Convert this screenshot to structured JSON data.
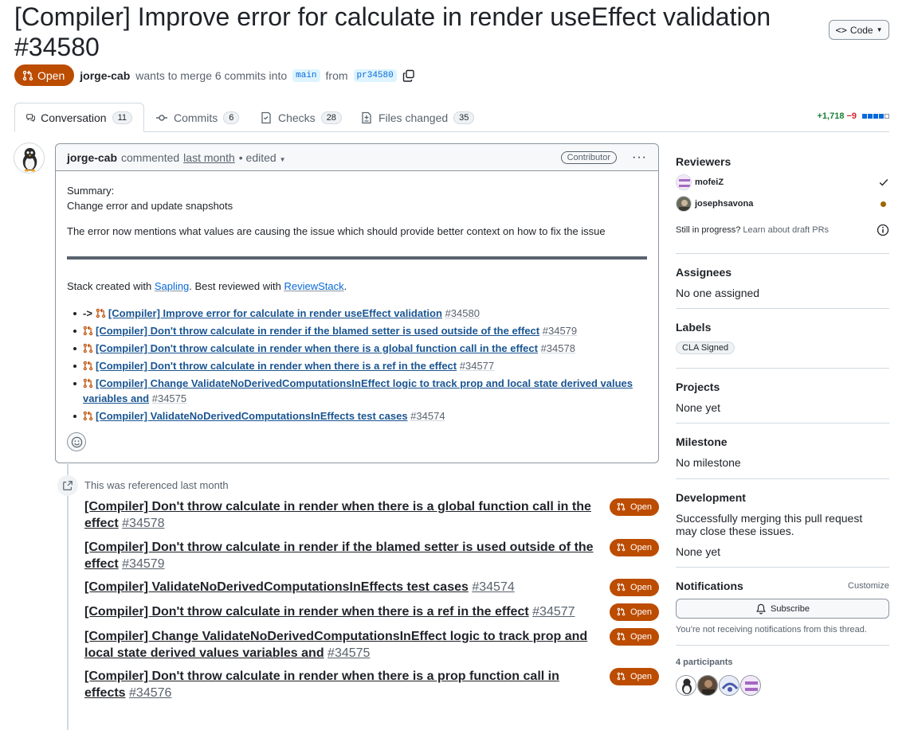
{
  "header": {
    "title": "[Compiler] Improve error for calculate in render useEffect validation",
    "number": "#34580",
    "code_button": "Code"
  },
  "meta": {
    "state": "Open",
    "author": "jorge-cab",
    "action": "wants to merge 6 commits into",
    "base_branch": "main",
    "from_word": "from",
    "head_branch": "pr34580"
  },
  "tabs": [
    {
      "label": "Conversation",
      "count": "11",
      "icon": "comment-discussion-icon"
    },
    {
      "label": "Commits",
      "count": "6",
      "icon": "git-commit-icon"
    },
    {
      "label": "Checks",
      "count": "28",
      "icon": "checklist-icon"
    },
    {
      "label": "Files changed",
      "count": "35",
      "icon": "file-diff-icon"
    }
  ],
  "diffstat": {
    "additions": "+1,718",
    "deletions": "−9"
  },
  "comment": {
    "author": "jorge-cab",
    "verb": "commented",
    "time": "last month",
    "edited": "• edited",
    "role": "Contributor",
    "summary_label": "Summary:",
    "summary_line": "Change error and update snapshots",
    "paragraph": "The error now mentions what values are causing the issue which should provide better context on how to fix the issue",
    "stack_prefix": "Stack created with",
    "stack_tool": "Sapling",
    "stack_mid": ". Best reviewed with",
    "stack_review": "ReviewStack",
    "stack_end": ".",
    "stack": [
      {
        "prefix": "->",
        "title": "[Compiler] Improve error for calculate in render useEffect validation",
        "num": "#34580"
      },
      {
        "prefix": "",
        "title": "[Compiler] Don't throw calculate in render if the blamed setter is used outside of the effect",
        "num": "#34579"
      },
      {
        "prefix": "",
        "title": "[Compiler] Don't throw calculate in render when there is a global function call in the effect",
        "num": "#34578"
      },
      {
        "prefix": "",
        "title": "[Compiler] Don't throw calculate in render when there is a ref in the effect",
        "num": "#34577"
      },
      {
        "prefix": "",
        "title": "[Compiler] Change ValidateNoDerivedComputationsInEffect logic to track prop and local state derived values variables and",
        "num": "#34575"
      },
      {
        "prefix": "",
        "title": "[Compiler] ValidateNoDerivedComputationsInEffects test cases",
        "num": "#34574"
      }
    ]
  },
  "references": {
    "text": "This was referenced last month",
    "items": [
      {
        "title": "[Compiler] Don't throw calculate in render when there is a global function call in the effect",
        "num": "#34578",
        "state": "Open"
      },
      {
        "title": "[Compiler] Don't throw calculate in render if the blamed setter is used outside of the effect",
        "num": "#34579",
        "state": "Open"
      },
      {
        "title": "[Compiler] ValidateNoDerivedComputationsInEffects test cases",
        "num": "#34574",
        "state": "Open"
      },
      {
        "title": "[Compiler] Don't throw calculate in render when there is a ref in the effect",
        "num": "#34577",
        "state": "Open"
      },
      {
        "title": "[Compiler] Change ValidateNoDerivedComputationsInEffect logic to track prop and local state derived values variables and",
        "num": "#34575",
        "state": "Open"
      },
      {
        "title": "[Compiler] Don't throw calculate in render when there is a prop function call in effects",
        "num": "#34576",
        "state": "Open"
      }
    ]
  },
  "sidebar": {
    "reviewers_title": "Reviewers",
    "reviewers": [
      {
        "name": "mofeiZ",
        "status": "approved-check-icon"
      },
      {
        "name": "josephsavona",
        "status": "pending-dot-icon"
      }
    ],
    "draft_text": "Still in progress?",
    "draft_link": "Learn about draft PRs",
    "assignees_title": "Assignees",
    "assignees_value": "No one assigned",
    "labels_title": "Labels",
    "label": "CLA Signed",
    "projects_title": "Projects",
    "projects_value": "None yet",
    "milestone_title": "Milestone",
    "milestone_value": "No milestone",
    "development_title": "Development",
    "development_text": "Successfully merging this pull request may close these issues.",
    "development_value": "None yet",
    "notifications_title": "Notifications",
    "customize": "Customize",
    "subscribe": "Subscribe",
    "notif_text": "You’re not receiving notifications from this thread.",
    "participants_title": "4 participants"
  },
  "colors": {
    "open": "#bc4c00",
    "link": "#0969da",
    "add": "#1a7f37",
    "del": "#d1242f"
  }
}
